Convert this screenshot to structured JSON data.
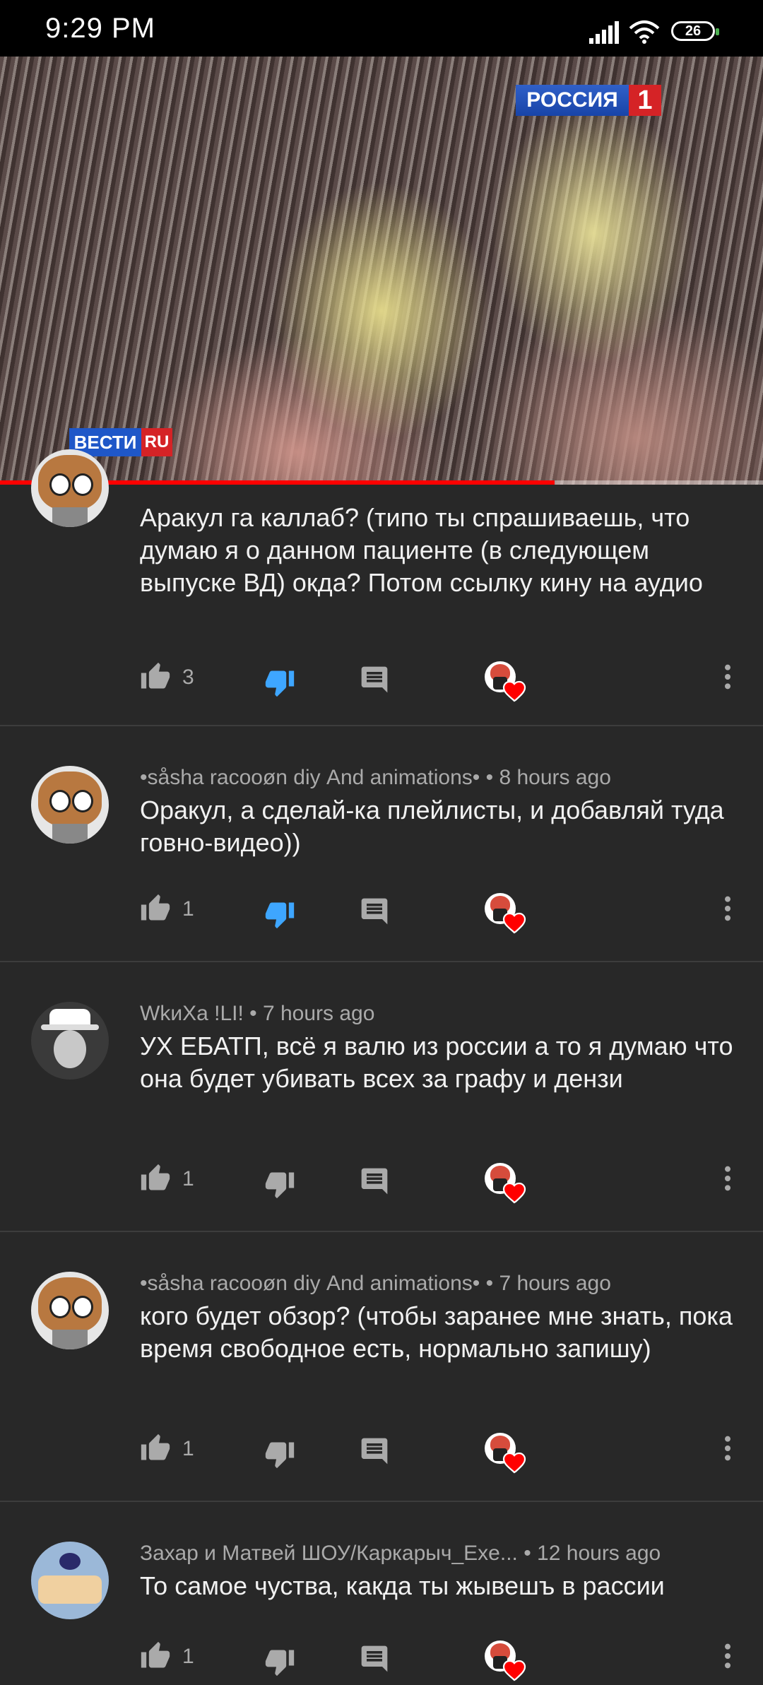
{
  "status_bar": {
    "time": "9:29 PM",
    "battery": "26"
  },
  "video": {
    "channel_logo": "РОССИЯ",
    "channel_number": "1",
    "news_logo": "ВЕСТИ",
    "news_logo_suffix": "RU",
    "progress_fraction": 0.727
  },
  "comments": [
    {
      "author": "",
      "time": "",
      "text": "Аракул га каллаб? (типо ты спрашиваешь, что думаю я о данном пациенте (в следующем выпуске ВД) окда? Потом ссылку кину на аудио",
      "likes": "3",
      "disliked": true,
      "avatar": "racoon-avatar"
    },
    {
      "author": "•såsha racooøn diy Аnd animations•",
      "time": "• 8 hours ago",
      "text": "Оракул, а сделай-ка плейлисты, и добавляй туда говно-видео))",
      "likes": "1",
      "disliked": true,
      "avatar": "racoon-avatar"
    },
    {
      "author": "WkиXa !LI!",
      "time": "• 7 hours ago",
      "text": "УХ ЕБАТП, всё я валю из россии а то я думаю что она будет убивать всех за графу и дензи",
      "likes": "1",
      "disliked": false,
      "avatar": "ghost-avatar"
    },
    {
      "author": "•såsha racooøn diy Аnd animations•",
      "time": "• 7 hours ago",
      "text": "кого будет обзор? (чтобы заранее мне знать, пока время свободное есть, нормально запишу)",
      "likes": "1",
      "disliked": false,
      "avatar": "racoon-avatar"
    },
    {
      "author": "Захар и Матвей ШОУ/Каркарыч_Exe...",
      "time": "• 12 hours ago",
      "text": "То самое чуства, какда ты жывешъ в рассии",
      "likes": "1",
      "disliked": false,
      "avatar": "cake-avatar"
    }
  ],
  "colors": {
    "accent_blue": "#3ea6ff",
    "progress_red": "#ff0000",
    "heart_red": "#ff0000"
  }
}
